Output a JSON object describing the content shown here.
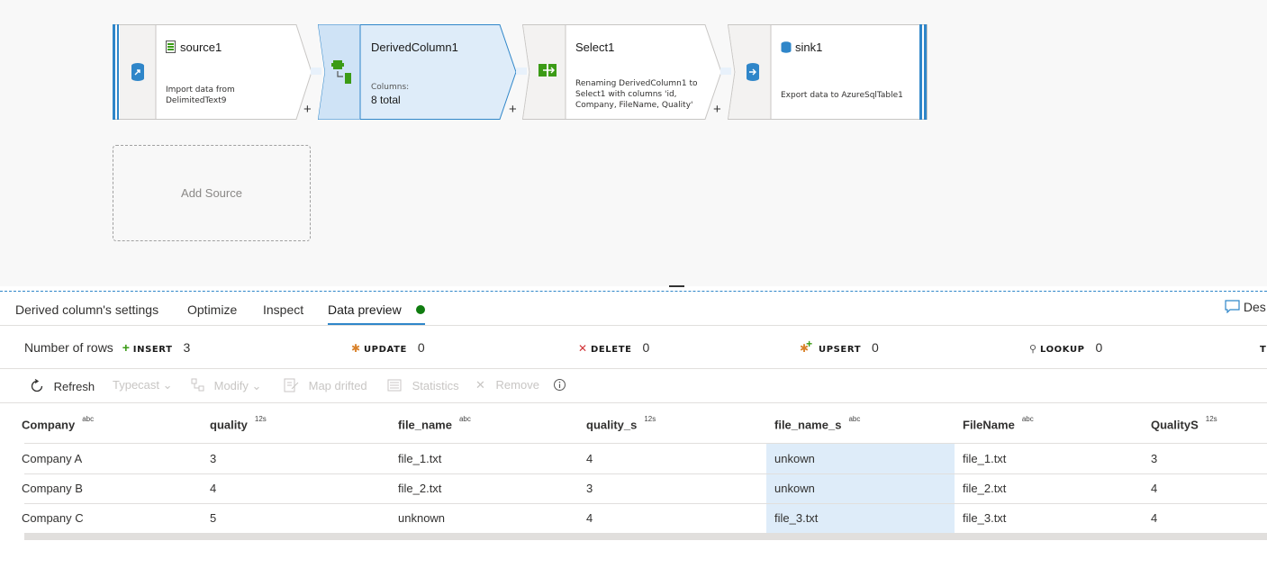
{
  "flow": {
    "source": {
      "title": "source1",
      "desc_line1": "Import data from",
      "desc_line2": "DelimitedText9"
    },
    "derived": {
      "title": "DerivedColumn1",
      "columns_label": "Columns:",
      "columns_value": "8 total"
    },
    "select": {
      "title": "Select1",
      "desc_line1": "Renaming DerivedColumn1 to",
      "desc_line2": "Select1 with columns 'id,",
      "desc_line3": "Company, FileName, Quality'"
    },
    "sink": {
      "title": "sink1",
      "desc": "Export data to AzureSqlTable1"
    },
    "plus": "+",
    "add_source": "Add Source"
  },
  "tabs": {
    "settings": "Derived column's settings",
    "optimize": "Optimize",
    "inspect": "Inspect",
    "preview": "Data preview",
    "desc": "Des"
  },
  "stats": {
    "rows_label": "Number of rows",
    "insert_label": "INSERT",
    "insert_value": "3",
    "update_label": "UPDATE",
    "update_value": "0",
    "delete_label": "DELETE",
    "delete_value": "0",
    "upsert_label": "UPSERT",
    "upsert_value": "0",
    "lookup_label": "LOOKUP",
    "lookup_value": "0",
    "extra": "T"
  },
  "toolbar": {
    "refresh": "Refresh",
    "typecast": "Typecast",
    "modify": "Modify",
    "map_drifted": "Map drifted",
    "statistics": "Statistics",
    "remove": "Remove"
  },
  "table": {
    "columns": [
      {
        "name": "Company",
        "type": "abc"
      },
      {
        "name": "quality",
        "type": "12s"
      },
      {
        "name": "file_name",
        "type": "abc"
      },
      {
        "name": "quality_s",
        "type": "12s"
      },
      {
        "name": "file_name_s",
        "type": "abc"
      },
      {
        "name": "FileName",
        "type": "abc"
      },
      {
        "name": "QualityS",
        "type": "12s"
      }
    ],
    "rows": [
      [
        "Company A",
        "3",
        "file_1.txt",
        "4",
        "unkown",
        "file_1.txt",
        "3"
      ],
      [
        "Company B",
        "4",
        "file_2.txt",
        "3",
        "unkown",
        "file_2.txt",
        "4"
      ],
      [
        "Company C",
        "5",
        "unknown",
        "4",
        "file_3.txt",
        "file_3.txt",
        "4"
      ]
    ]
  },
  "colors": {
    "accent": "#2f86c9",
    "selected_fill": "#deecf9",
    "status_green": "#107c10",
    "icon_green": "#3b9b16"
  }
}
